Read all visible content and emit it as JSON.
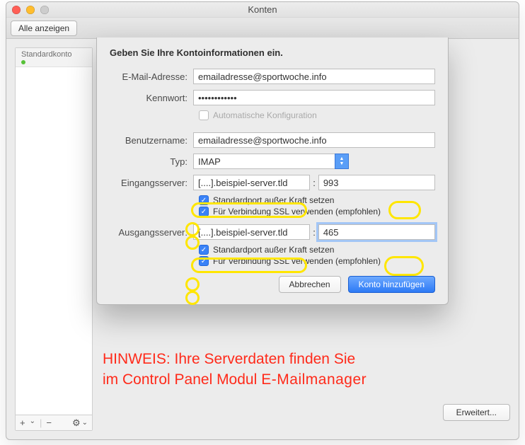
{
  "window": {
    "title": "Konten",
    "toolbar_show_all": "Alle anzeigen"
  },
  "sidebar": {
    "header_label": "Standardkonto",
    "footer": {
      "add": "+",
      "remove": "−",
      "dropdown": "⌄",
      "gear": "⚙",
      "gear_dd": "⌄"
    }
  },
  "sheet": {
    "heading": "Geben Sie Ihre Kontoinformationen ein.",
    "email_label": "E-Mail-Adresse:",
    "email_value": "emailadresse@sportwoche.info",
    "password_label": "Kennwort:",
    "password_value": "••••••••••••",
    "auto_config_label": "Automatische Konfiguration",
    "username_label": "Benutzername:",
    "username_value": "emailadresse@sportwoche.info",
    "type_label": "Typ:",
    "type_value": "IMAP",
    "incoming_label": "Eingangsserver:",
    "incoming_value": "[....].beispiel-server.tld",
    "incoming_port": "993",
    "override_port_label": "Standardport außer Kraft setzen",
    "use_ssl_label": "Für Verbindung SSL verwenden (empfohlen)",
    "outgoing_label": "Ausgangsserver:",
    "outgoing_value": "[....].beispiel-server.tld",
    "outgoing_port": "465",
    "cancel_label": "Abbrechen",
    "submit_label": "Konto hinzufügen"
  },
  "hint_line1": "HINWEIS: Ihre Serverdaten finden Sie",
  "hint_line2a": "im Control Panel Modul",
  "hint_line2b": "E-Mailmanager",
  "advanced_label": "Erweitert..."
}
